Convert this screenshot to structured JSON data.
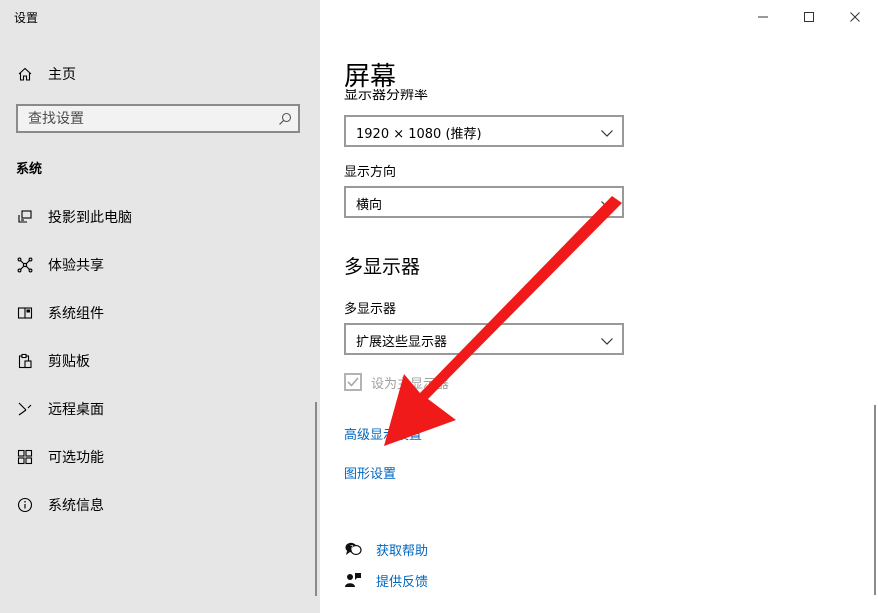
{
  "app": {
    "title": "设置"
  },
  "sidebar": {
    "home_label": "主页",
    "search": {
      "placeholder": "查找设置",
      "value": ""
    },
    "section_title": "系统",
    "items": [
      {
        "label": "投影到此电脑",
        "icon": "project-icon"
      },
      {
        "label": "体验共享",
        "icon": "share-icon"
      },
      {
        "label": "系统组件",
        "icon": "components-icon"
      },
      {
        "label": "剪贴板",
        "icon": "clipboard-icon"
      },
      {
        "label": "远程桌面",
        "icon": "remote-desktop-icon"
      },
      {
        "label": "可选功能",
        "icon": "optional-features-icon"
      },
      {
        "label": "系统信息",
        "icon": "info-icon"
      }
    ]
  },
  "main": {
    "page_title": "屏幕",
    "resolution": {
      "label": "显示器分辨率",
      "value": "1920 × 1080 (推荐)"
    },
    "orientation": {
      "label": "显示方向",
      "value": "横向"
    },
    "multi_display": {
      "heading": "多显示器",
      "label": "多显示器",
      "value": "扩展这些显示器",
      "make_main_label": "设为主显示器",
      "make_main_checked": true,
      "make_main_enabled": false
    },
    "links": {
      "advanced": "高级显示设置",
      "graphics": "图形设置"
    },
    "help": {
      "get_help": "获取帮助",
      "feedback": "提供反馈"
    }
  },
  "colors": {
    "sidebar_bg": "#e6e6e6",
    "link": "#0067c0",
    "annotation_arrow": "#f01a1a"
  }
}
